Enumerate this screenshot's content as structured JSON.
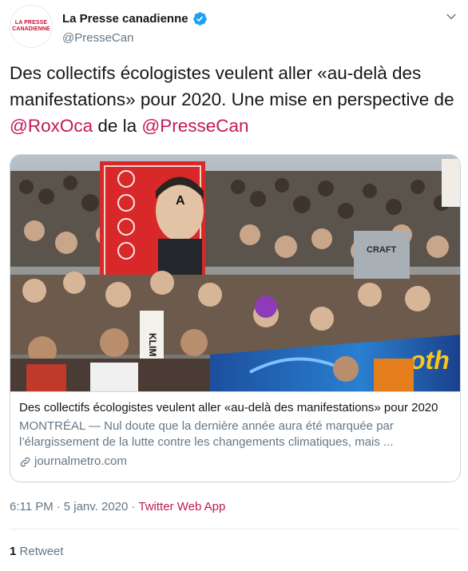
{
  "author": {
    "display_name": "La Presse canadienne",
    "handle": "@PresseCan",
    "avatar_text_line1": "LA PRESSE",
    "avatar_text_line2": "CANADIENNE",
    "verified_icon": "verified-badge-icon"
  },
  "tweet": {
    "text_part1": "Des collectifs écologistes veulent aller «au-delà des manifestations» pour 2020. Une mise en perspective de ",
    "mention1": "@RoxOca",
    "text_part2": " de la ",
    "mention2": "@PresseCan"
  },
  "card": {
    "title": "Des collectifs écologistes veulent aller «au-delà des manifestations» pour 2020",
    "description": "MONTRÉAL — Nul doute que la dernière année aura été marquée par l’élargissement de la lutte contre les changements climatiques, mais ...",
    "domain": "journalmetro.com",
    "image_signs": [
      "KLIM",
      "CRAFT",
      "A",
      "oth"
    ]
  },
  "footer": {
    "time": "6:11 PM",
    "separator": "·",
    "date": "5 janv. 2020",
    "separator2": "·",
    "source": "Twitter Web App",
    "retweet_count": "1",
    "retweet_label": "Retweet"
  },
  "colors": {
    "accent": "#c2185b",
    "secondary_text": "#657786",
    "verified": "#1da1f2",
    "avatar_brand": "#c8102e"
  }
}
